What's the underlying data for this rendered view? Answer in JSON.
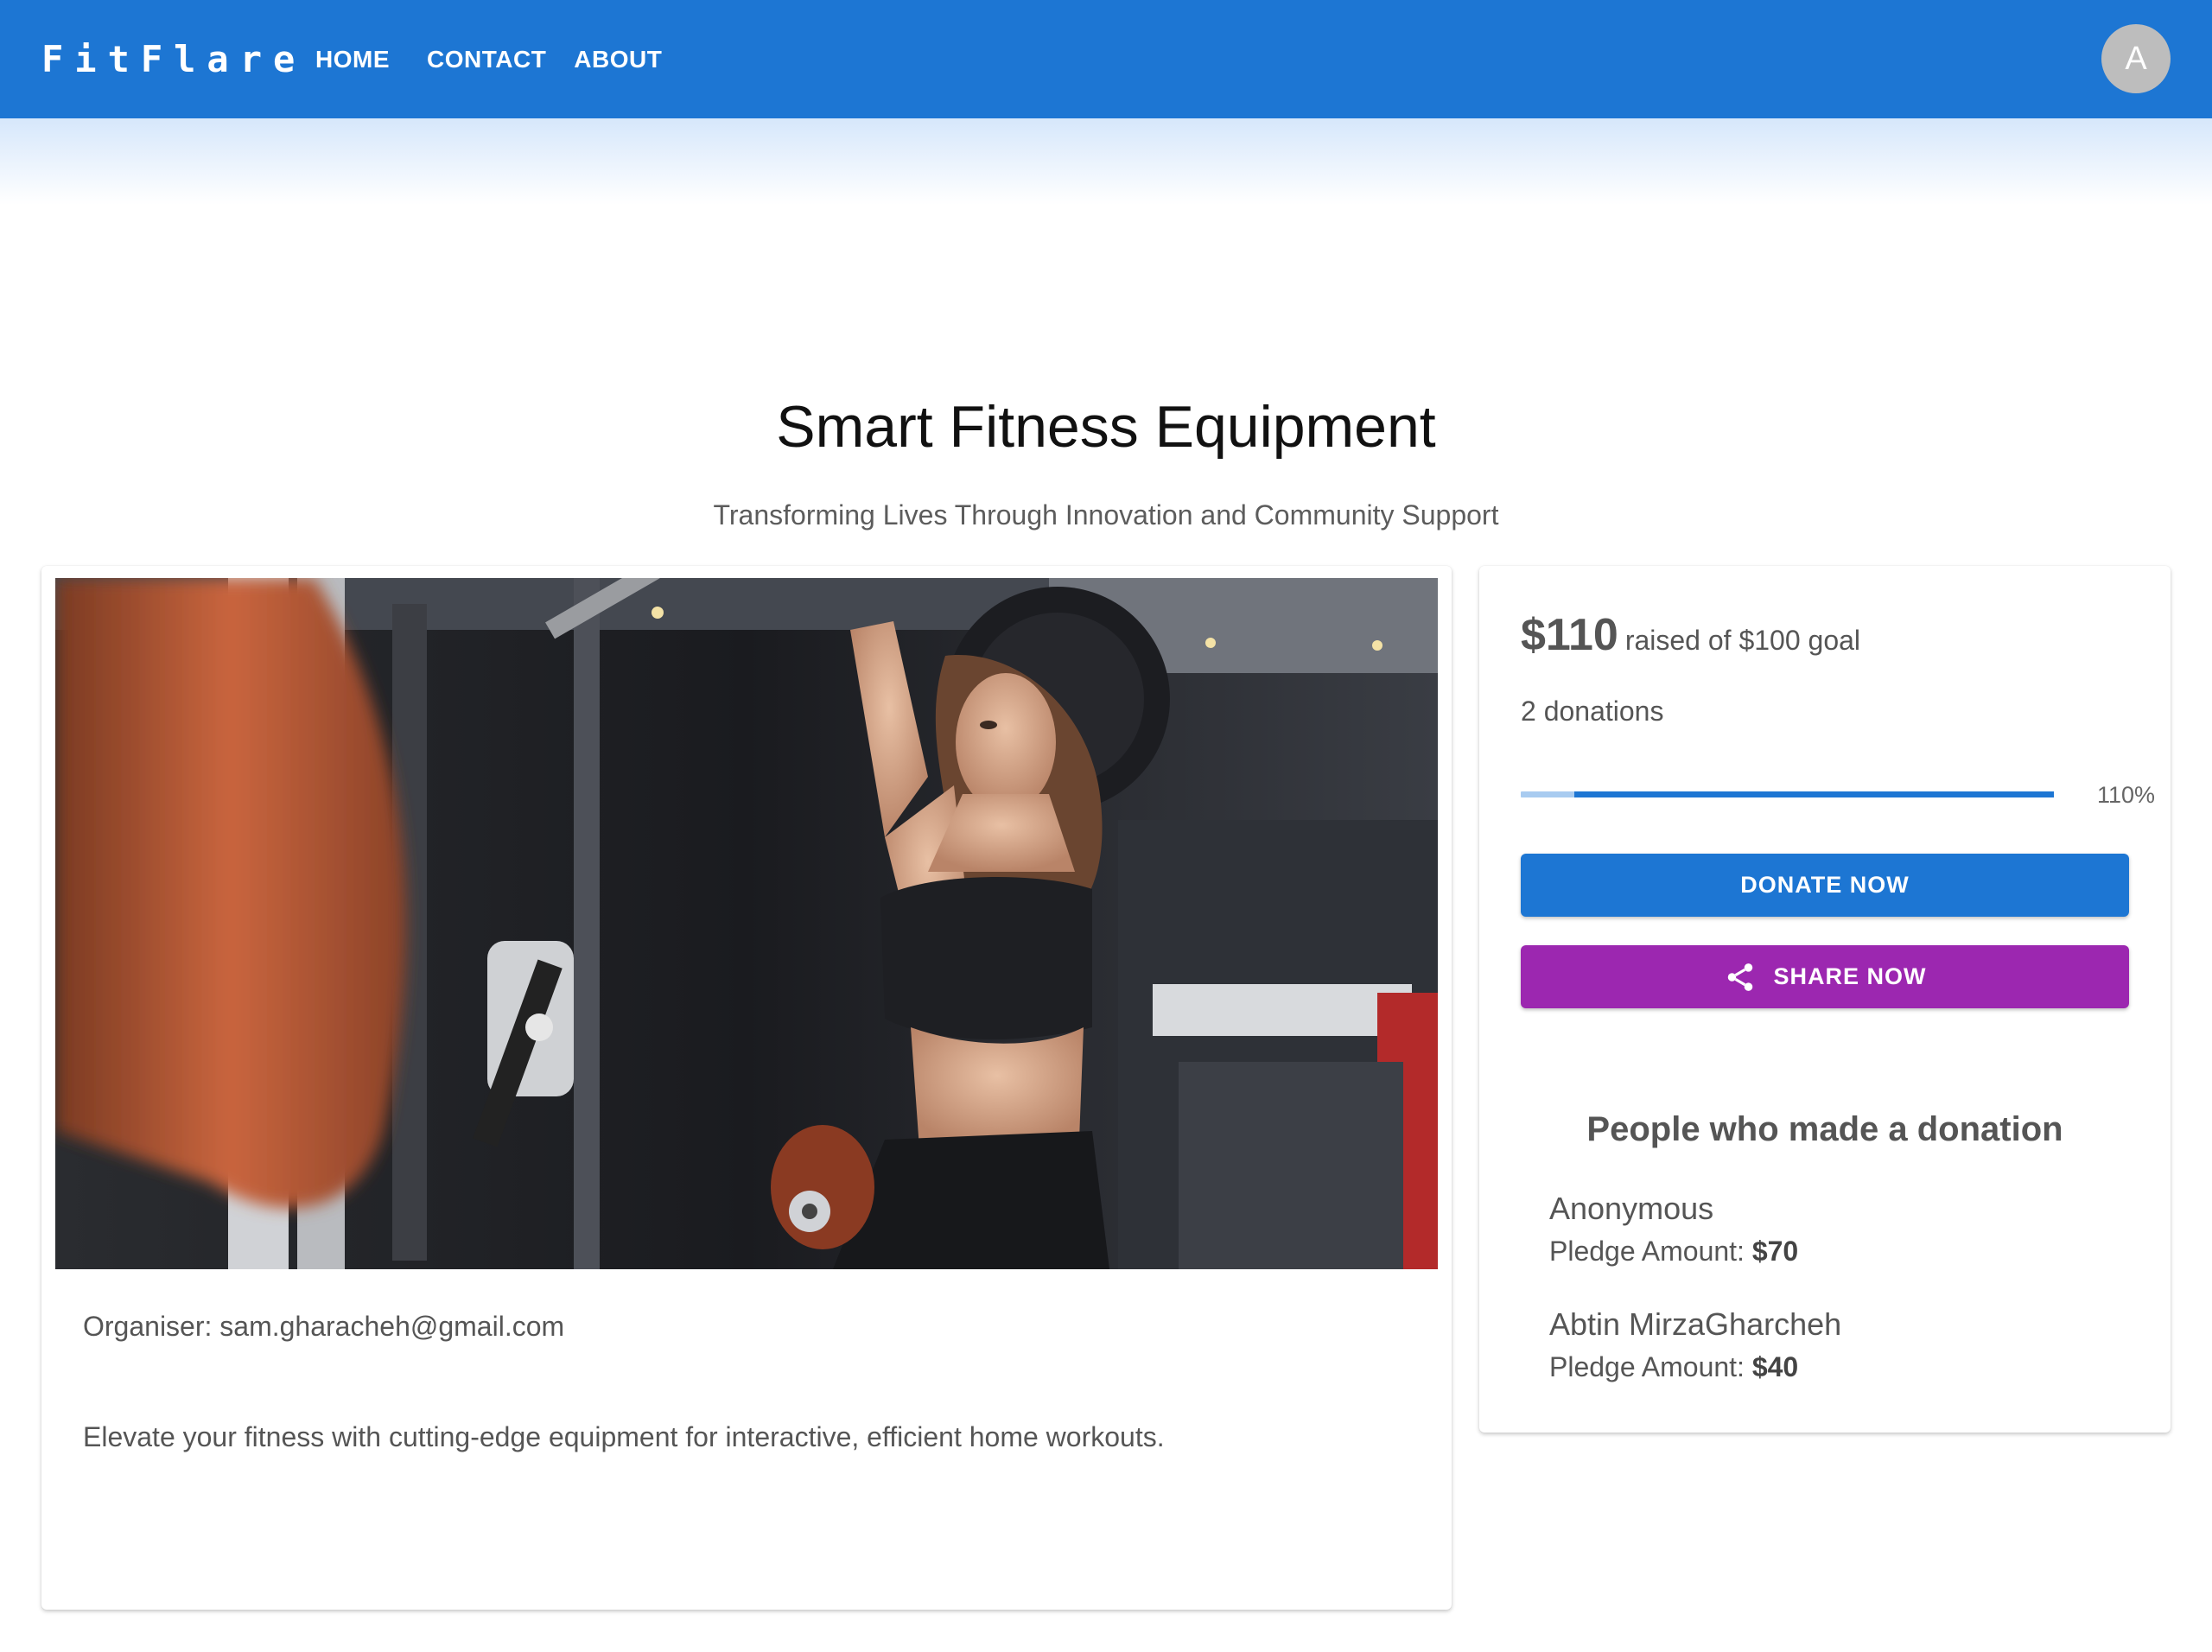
{
  "header": {
    "brand": "FitFlare",
    "nav": {
      "home": "HOME",
      "contact": "CONTACT",
      "about": "ABOUT"
    },
    "avatar_initial": "A"
  },
  "page": {
    "title": "Smart Fitness Equipment",
    "subtitle": "Transforming Lives Through Innovation and Community Support"
  },
  "campaign": {
    "organiser": "Organiser: sam.gharacheh@gmail.com",
    "description": "Elevate your fitness with cutting-edge equipment for interactive, efficient home workouts."
  },
  "funding": {
    "raised": "$110",
    "goal_text": "raised of $100 goal",
    "donations": "2 donations",
    "percent_label": "110%",
    "progress_fraction": 1.0,
    "donate_label": "DONATE NOW",
    "share_label": "SHARE NOW"
  },
  "donors": {
    "title": "People who made a donation",
    "pledge_prefix": "Pledge Amount: ",
    "list": [
      {
        "name": "Anonymous",
        "amount": "$70"
      },
      {
        "name": "Abtin MirzaGharcheh",
        "amount": "$40"
      }
    ]
  },
  "colors": {
    "primary": "#1d76d3",
    "secondary": "#9c27b0",
    "progress_track": "#a8cbf0"
  }
}
